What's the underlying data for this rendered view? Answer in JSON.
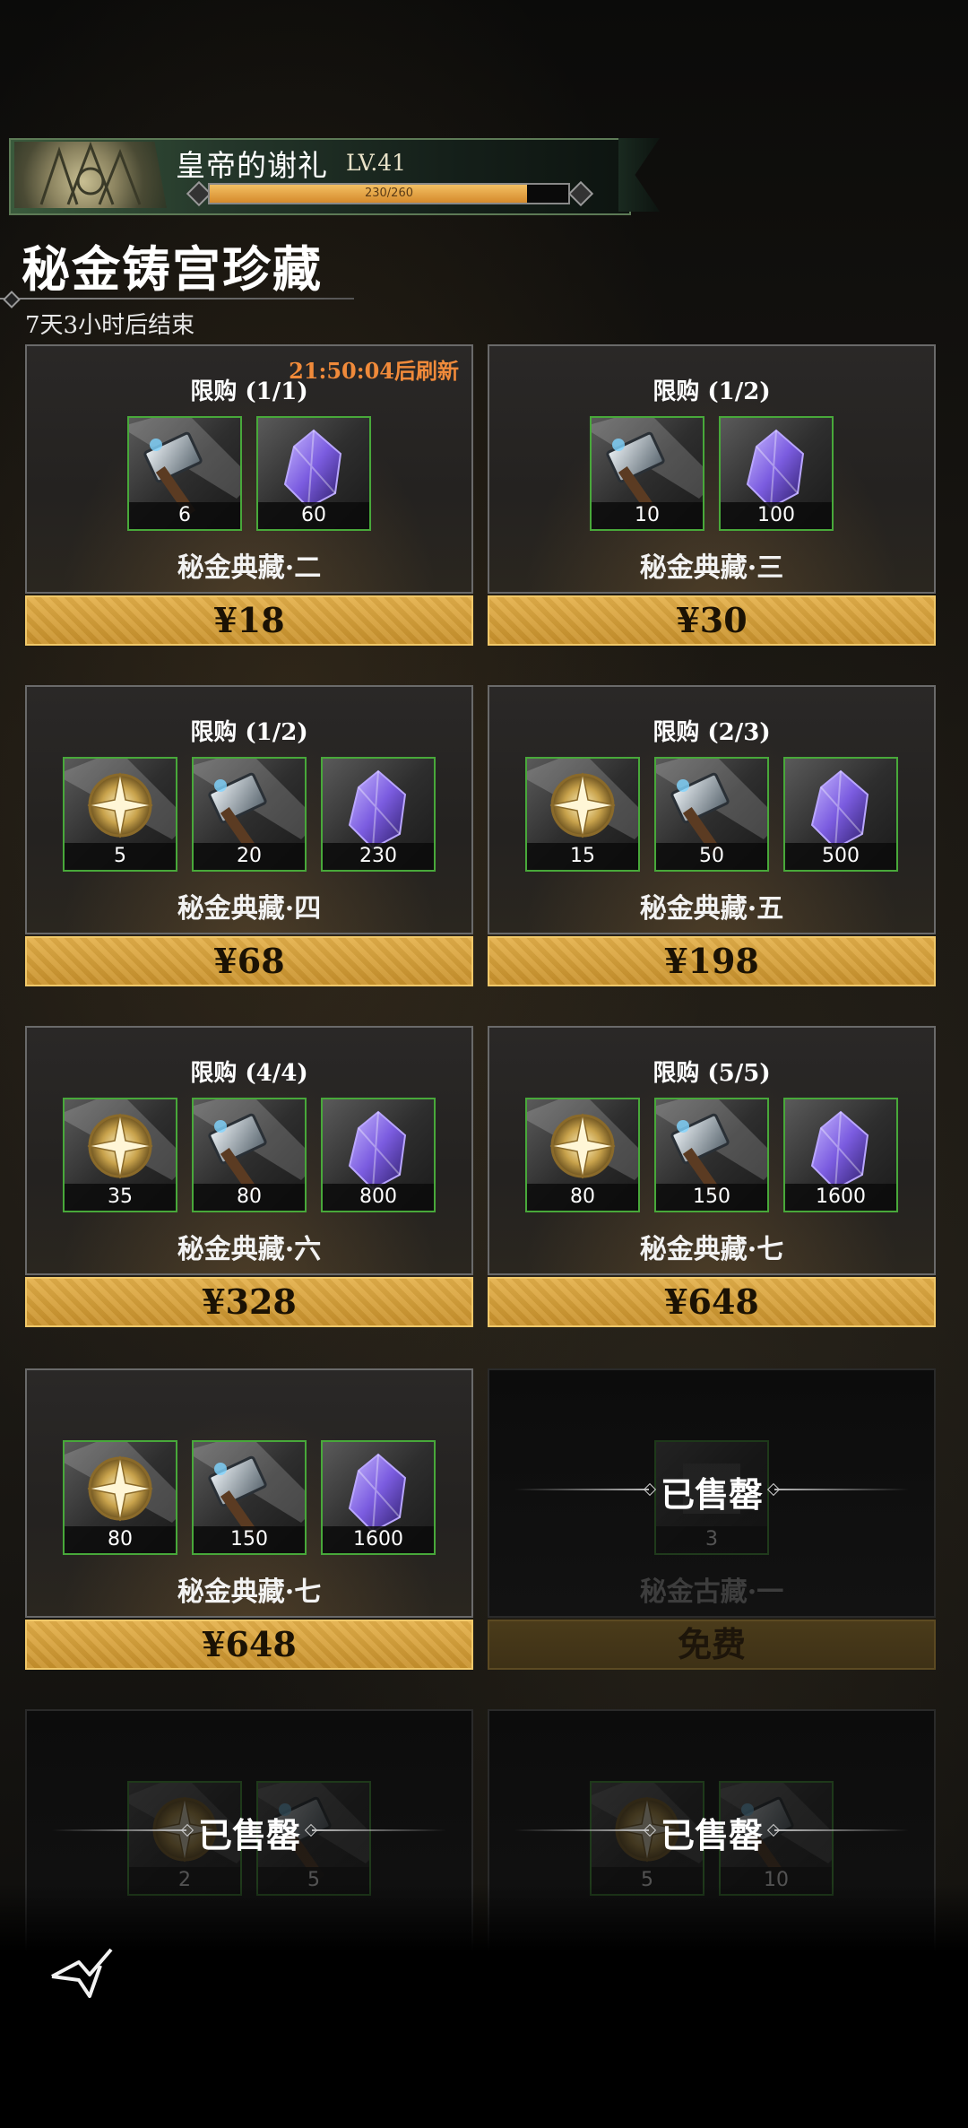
{
  "banner": {
    "title": "皇帝的谢礼",
    "level": "LV.41",
    "xp_text": "230/260",
    "xp_fraction": 0.885
  },
  "page": {
    "title": "秘金铸宫珍藏",
    "countdown": "7天3小时后结束",
    "refresh": "21:50:04后刷新"
  },
  "cards": [
    {
      "limit": "限购 (1/1)",
      "name": "秘金典藏·二",
      "price": "¥18",
      "items": [
        {
          "icon": "hammer-icon",
          "qty": "6"
        },
        {
          "icon": "crystal-icon",
          "qty": "60"
        }
      ]
    },
    {
      "limit": "限购 (1/2)",
      "name": "秘金典藏·三",
      "price": "¥30",
      "items": [
        {
          "icon": "hammer-icon",
          "qty": "10"
        },
        {
          "icon": "crystal-icon",
          "qty": "100"
        }
      ]
    },
    {
      "limit": "限购 (1/2)",
      "name": "秘金典藏·四",
      "price": "¥68",
      "items": [
        {
          "icon": "compass-medal-icon",
          "qty": "5"
        },
        {
          "icon": "hammer-icon",
          "qty": "20"
        },
        {
          "icon": "crystal-icon",
          "qty": "230"
        }
      ]
    },
    {
      "limit": "限购 (2/3)",
      "name": "秘金典藏·五",
      "price": "¥198",
      "items": [
        {
          "icon": "compass-medal-icon",
          "qty": "15"
        },
        {
          "icon": "hammer-icon",
          "qty": "50"
        },
        {
          "icon": "crystal-icon",
          "qty": "500"
        }
      ]
    },
    {
      "limit": "限购 (4/4)",
      "name": "秘金典藏·六",
      "price": "¥328",
      "items": [
        {
          "icon": "compass-medal-icon",
          "qty": "35"
        },
        {
          "icon": "hammer-icon",
          "qty": "80"
        },
        {
          "icon": "crystal-icon",
          "qty": "800"
        }
      ]
    },
    {
      "limit": "限购 (5/5)",
      "name": "秘金典藏·七",
      "price": "¥648",
      "items": [
        {
          "icon": "compass-medal-icon",
          "qty": "80"
        },
        {
          "icon": "hammer-icon",
          "qty": "150"
        },
        {
          "icon": "crystal-icon",
          "qty": "1600"
        }
      ]
    },
    {
      "limit": "",
      "name": "秘金典藏·七",
      "price": "¥648",
      "items": [
        {
          "icon": "compass-medal-icon",
          "qty": "80"
        },
        {
          "icon": "hammer-icon",
          "qty": "150"
        },
        {
          "icon": "crystal-icon",
          "qty": "1600"
        }
      ]
    },
    {
      "sold": "已售罄",
      "name": "秘金古藏·一",
      "price": "免费",
      "items": [
        {
          "icon": "item-icon",
          "qty": "3"
        }
      ]
    },
    {
      "sold": "已售罄",
      "name": "",
      "price": "",
      "items": [
        {
          "icon": "compass-medal-icon",
          "qty": "2"
        },
        {
          "icon": "hammer-icon",
          "qty": "5"
        }
      ]
    },
    {
      "sold": "已售罄",
      "name": "",
      "price": "",
      "items": [
        {
          "icon": "compass-medal-icon",
          "qty": "5"
        },
        {
          "icon": "hammer-icon",
          "qty": "10"
        }
      ]
    }
  ],
  "colors": {
    "accent_gold": "#d9a23c",
    "item_border": "#48a83a",
    "refresh": "#f08a3a"
  },
  "nav": {
    "back_icon": "back-icon"
  }
}
